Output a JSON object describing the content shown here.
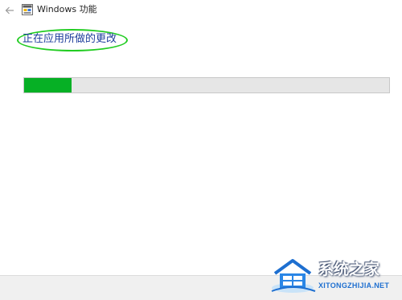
{
  "window": {
    "title": "Windows 功能"
  },
  "icons": {
    "back": "back-arrow-icon",
    "app": "windows-features-icon"
  },
  "status": {
    "text": "正在应用所做的更改"
  },
  "progress": {
    "percent": 13,
    "fill_color": "#06b025",
    "track_color": "#e6e6e6"
  },
  "watermark": {
    "text_cn": "系统之家",
    "text_en": "XITONGZHIJIA.NET"
  },
  "colors": {
    "highlight_ellipse": "#22cc22",
    "status_text": "#1f3e9c"
  }
}
